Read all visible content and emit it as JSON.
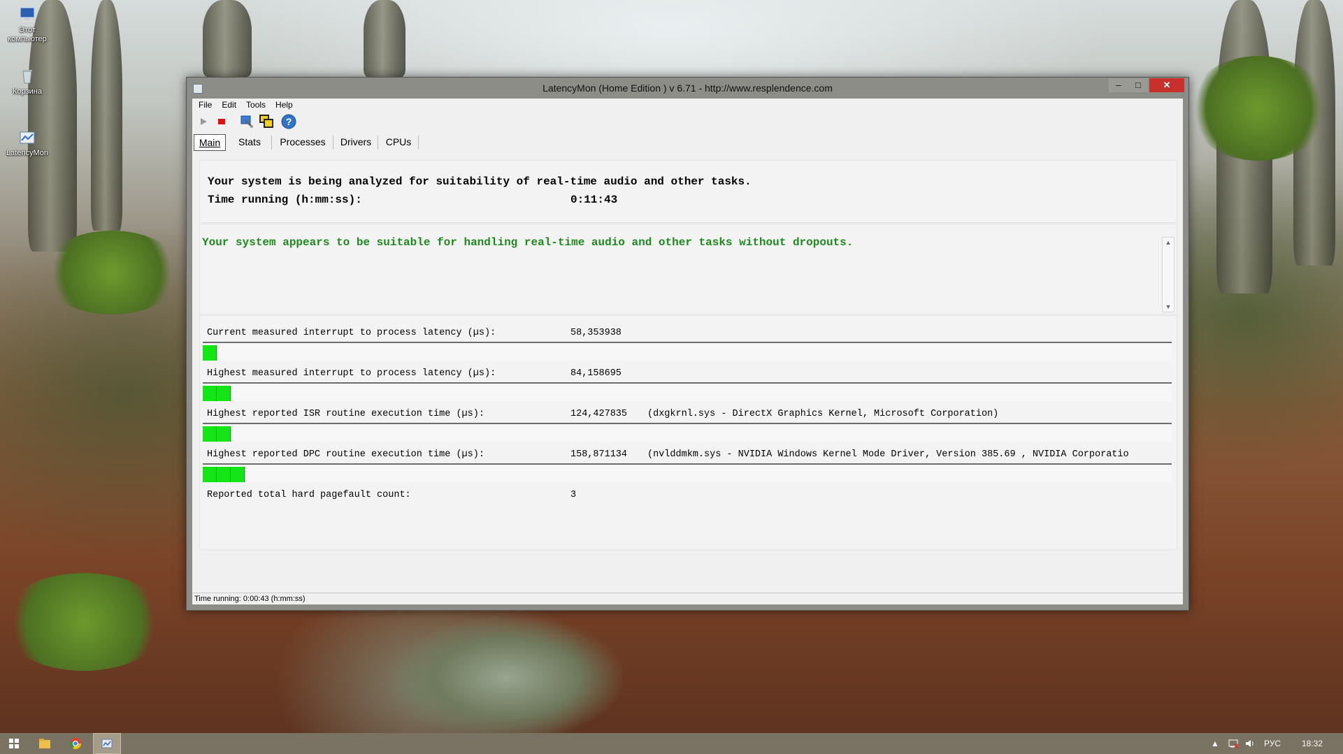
{
  "desktop": {
    "icons": [
      {
        "label": "Этот компьютер",
        "icon": "computer-icon"
      },
      {
        "label": "Корзина",
        "icon": "recycle-bin-icon"
      },
      {
        "label": "LatencyMon",
        "icon": "latencymon-shortcut-icon"
      }
    ]
  },
  "window": {
    "title": "LatencyMon  (Home Edition )  v 6.71 - http://www.resplendence.com",
    "controls": {
      "minimize": "–",
      "maximize": "□",
      "close": "✕"
    },
    "menu": [
      "File",
      "Edit",
      "Tools",
      "Help"
    ],
    "toolbar": [
      {
        "name": "start-icon",
        "tooltip": "Start"
      },
      {
        "name": "stop-icon",
        "tooltip": "Stop"
      },
      {
        "name": "cpu-tool-icon",
        "tooltip": "Tools"
      },
      {
        "name": "windows-icon",
        "tooltip": "Windows"
      },
      {
        "name": "help-icon",
        "tooltip": "Help"
      }
    ],
    "tabs": [
      "Main",
      "Stats",
      "Processes",
      "Drivers",
      "CPUs"
    ],
    "active_tab": "Main"
  },
  "main": {
    "analyzing_text": "Your system is being analyzed for suitability of real-time audio and other tasks.",
    "time_running_label": "Time running (h:mm:ss):",
    "time_running_value": "0:11:43",
    "conclusion": "Your system appears to be suitable for handling real-time audio and other tasks without dropouts.",
    "metrics": [
      {
        "label": "Current measured interrupt to process latency (µs):",
        "value": "58,353938",
        "note": "",
        "bar_segments": 1
      },
      {
        "label": "Highest measured interrupt to process latency (µs):",
        "value": "84,158695",
        "note": "",
        "bar_segments": 2
      },
      {
        "label": "Highest reported ISR routine execution time (µs):",
        "value": "124,427835",
        "note": "(dxgkrnl.sys - DirectX Graphics Kernel, Microsoft Corporation)",
        "bar_segments": 2
      },
      {
        "label": "Highest reported DPC routine execution time (µs):",
        "value": "158,871134",
        "note": "(nvlddmkm.sys - NVIDIA Windows Kernel Mode Driver, Version 385.69 , NVIDIA Corporatio",
        "bar_segments": 3
      },
      {
        "label": "Reported total hard pagefault count:",
        "value": "3",
        "note": "",
        "bar_segments": 0
      }
    ]
  },
  "statusbar": {
    "text": "Time running: 0:00:43  (h:mm:ss)"
  },
  "taskbar": {
    "items": [
      "start-icon",
      "file-explorer-icon",
      "chrome-icon",
      "latencymon-taskbar-icon"
    ],
    "tray": {
      "language": "РУС",
      "time": "18:32"
    }
  },
  "colors": {
    "meter_green": "#14e514",
    "conclusion_green": "#1d8a1d",
    "close_red": "#c7302b"
  }
}
